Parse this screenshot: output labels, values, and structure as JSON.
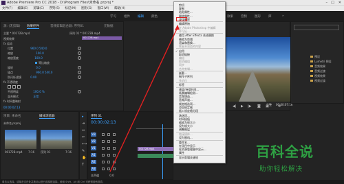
{
  "app": {
    "title": "Adobe Premiere Pro CC 2018 - D:\\Program Files\\未命名.prproj *",
    "menu": [
      "文件(F)",
      "编辑(E)",
      "剪辑(C)",
      "序列(S)",
      "标记(M)",
      "图形(G)",
      "窗口(W)",
      "帮助(H)"
    ]
  },
  "workspaces": [
    "学习",
    "组件",
    "编辑",
    "颜色",
    "效果",
    "音频",
    "图形",
    "库"
  ],
  "source_panel": {
    "tabs": [
      "源: (无剪辑)",
      "效果控件",
      "音频剪辑混合器: 序列01",
      "元数据"
    ],
    "header": "主要 * 00172B.mp4",
    "sequence_label": "序列 01 * 00172B.mp4",
    "clip_label": "00172B.mp4",
    "rows": [
      {
        "label": "视频效果",
        "value": ""
      },
      {
        "label": "fx 运动",
        "value": ""
      },
      {
        "label": "位置",
        "value": "960.0   540.0"
      },
      {
        "label": "缩放",
        "value": "100.0"
      },
      {
        "label": "缩放宽度",
        "value": "100.0"
      },
      {
        "label": "等比缩放",
        "value": ""
      },
      {
        "label": "旋转",
        "value": "0.0"
      },
      {
        "label": "锚点",
        "value": "960.0   540.0"
      },
      {
        "label": "防闪烁滤镜",
        "value": "0.00"
      },
      {
        "label": "fx 不透明度",
        "value": ""
      },
      {
        "label": "不透明度",
        "value": "100.0 %"
      },
      {
        "label": "混合模式",
        "value": "正常"
      },
      {
        "label": "fx 时间重映射",
        "value": ""
      }
    ],
    "timecode": "00:00:02:13"
  },
  "project_panel": {
    "tabs": [
      "项目: 未命名",
      "媒体浏览器"
    ],
    "file": "未命名.prproj",
    "items": [
      {
        "name": "00172B.mp4",
        "duration": "7:16"
      },
      {
        "name": "序列 01",
        "duration": "7:16"
      }
    ]
  },
  "timeline": {
    "tab": "序列 01",
    "timecode": "00:00:02:13",
    "tracks": [
      "V3",
      "V2",
      "V1",
      "A1",
      "A2",
      "A3",
      "主声道"
    ],
    "clip_label": "00172B.mp4",
    "master_value": "0.0"
  },
  "program_monitor": {
    "fit": "完整",
    "timecode": "00:00:07:16"
  },
  "effects_panel": {
    "items": [
      "预设",
      "Lumetri 预设",
      "音频效果",
      "音频过渡",
      "视频效果",
      "视频过渡"
    ]
  },
  "context_menu": {
    "highlight_index": 4,
    "items": [
      {
        "label": "剪切",
        "enabled": true
      },
      {
        "label": "复制",
        "enabled": true
      },
      {
        "label": "粘贴属性...",
        "enabled": true
      },
      {
        "label": "删除属性...",
        "enabled": true
      },
      {
        "label": "波纹删除",
        "enabled": true
      },
      {
        "label": "编辑原始",
        "enabled": true
      },
      {
        "label": "在 Adobe Photoshop 中编辑",
        "enabled": false
      },
      {
        "label": "许可证...",
        "enabled": false
      },
      {
        "label": "使用 After Effects 合成替换",
        "enabled": true
      },
      {
        "label": "替换为剪辑",
        "enabled": true
      },
      {
        "label": "渲染和替换...",
        "enabled": true
      },
      {
        "label": "恢复未渲染的内容",
        "enabled": false
      },
      {
        "label": "启用",
        "enabled": true
      },
      {
        "label": "取消链接",
        "enabled": true
      },
      {
        "label": "编组",
        "enabled": false
      },
      {
        "label": "取消编组",
        "enabled": false
      },
      {
        "label": "同步",
        "enabled": false
      },
      {
        "label": "合并剪辑...",
        "enabled": false
      },
      {
        "label": "嵌套...",
        "enabled": true
      },
      {
        "label": "制作子序列",
        "enabled": true
      },
      {
        "label": "多机位",
        "enabled": false
      },
      {
        "label": "标签",
        "enabled": true
      },
      {
        "label": "速度/持续时间...",
        "enabled": true
      },
      {
        "label": "场景编辑检测...",
        "enabled": true
      },
      {
        "label": "音频增益...",
        "enabled": true
      },
      {
        "label": "音频声道...",
        "enabled": true
      },
      {
        "label": "帧定格选项...",
        "enabled": true
      },
      {
        "label": "添加帧定格",
        "enabled": true
      },
      {
        "label": "插入帧定格分段",
        "enabled": true
      },
      {
        "label": "场选项...",
        "enabled": true
      },
      {
        "label": "时间插值",
        "enabled": true
      },
      {
        "label": "缩放为帧大小",
        "enabled": true
      },
      {
        "label": "设为帧大小",
        "enabled": true
      },
      {
        "label": "调整图层",
        "enabled": true
      },
      {
        "label": "链接媒体...",
        "enabled": false
      },
      {
        "label": "设为脱机...",
        "enabled": true
      },
      {
        "label": "重命名...",
        "enabled": true
      },
      {
        "label": "在项目中显示",
        "enabled": true
      },
      {
        "label": "在资源管理器中显示...",
        "enabled": true
      },
      {
        "label": "属性",
        "enabled": true
      },
      {
        "label": "显示剪辑关键帧",
        "enabled": true
      }
    ]
  },
  "status_bar": "单击以选择，或单击空白处并拖动以进行选择框选择。使用 Shift、Alt 和 Ctrl 可获得其他选项。",
  "watermark": {
    "big": "百科全说",
    "small": "助你轻松解决"
  }
}
